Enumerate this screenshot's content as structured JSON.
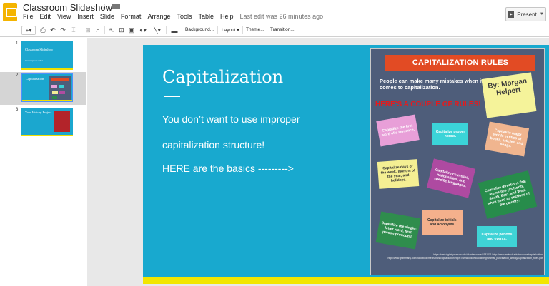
{
  "app": {
    "doc_title": "Classroom Slideshow",
    "menus": [
      "File",
      "Edit",
      "View",
      "Insert",
      "Slide",
      "Format",
      "Arrange",
      "Tools",
      "Table",
      "Help"
    ],
    "last_edit": "Last edit was 26 minutes ago",
    "present_label": "Present"
  },
  "toolbar": {
    "plus": "+",
    "background_label": "Background...",
    "layout_label": "Layout",
    "theme_label": "Theme...",
    "transition_label": "Transition..."
  },
  "filmstrip": [
    {
      "num": "1",
      "title": "Classroom Slideshow",
      "sub": "Lorem ipsum dolor"
    },
    {
      "num": "2",
      "title": "Capitalization",
      "sub": ""
    },
    {
      "num": "3",
      "title": "Your History Project",
      "sub": ""
    }
  ],
  "slide": {
    "title": "Capitalization",
    "line1": "You don’t want to use improper",
    "line2": "capitalization structure!",
    "line3": "HERE are the basics --------->"
  },
  "poster": {
    "banner": "CAPITALIZATION RULES",
    "tagline": "People can make many mistakes when it comes to capitalization.",
    "subhead": "HERE’S A COUPLE OF RULES!",
    "byline": "By: Morgan Helpert",
    "notes": [
      "Capitalize the first word of a sentence.",
      "Capitalize proper nouns.",
      "Capitalize major words in titles of books, articles, and songs.",
      "Capitalize days of the week, months of the year, and holidays.",
      "Capitalize countries, nationalities, and specific languages.",
      "Capitalize directions that are names (as North, South, East, and West when used as sections of the country.",
      "Capitalize the single-letter word, first person pronoun I.",
      "Capitalize initials, and acronyms.",
      "Capitalize periods and events."
    ],
    "credits": "https://cast.digital.pearson.edu/qkm/resource/1981011/\nhttp://www.fewtech.edu/resource/capitalization\nhttp://www.grammarly.com/handbook/mechanics/capitalization\nhttps://www.ohio.edu/online/grammar_punctuation_writing/capitalization_rules.pdf"
  }
}
